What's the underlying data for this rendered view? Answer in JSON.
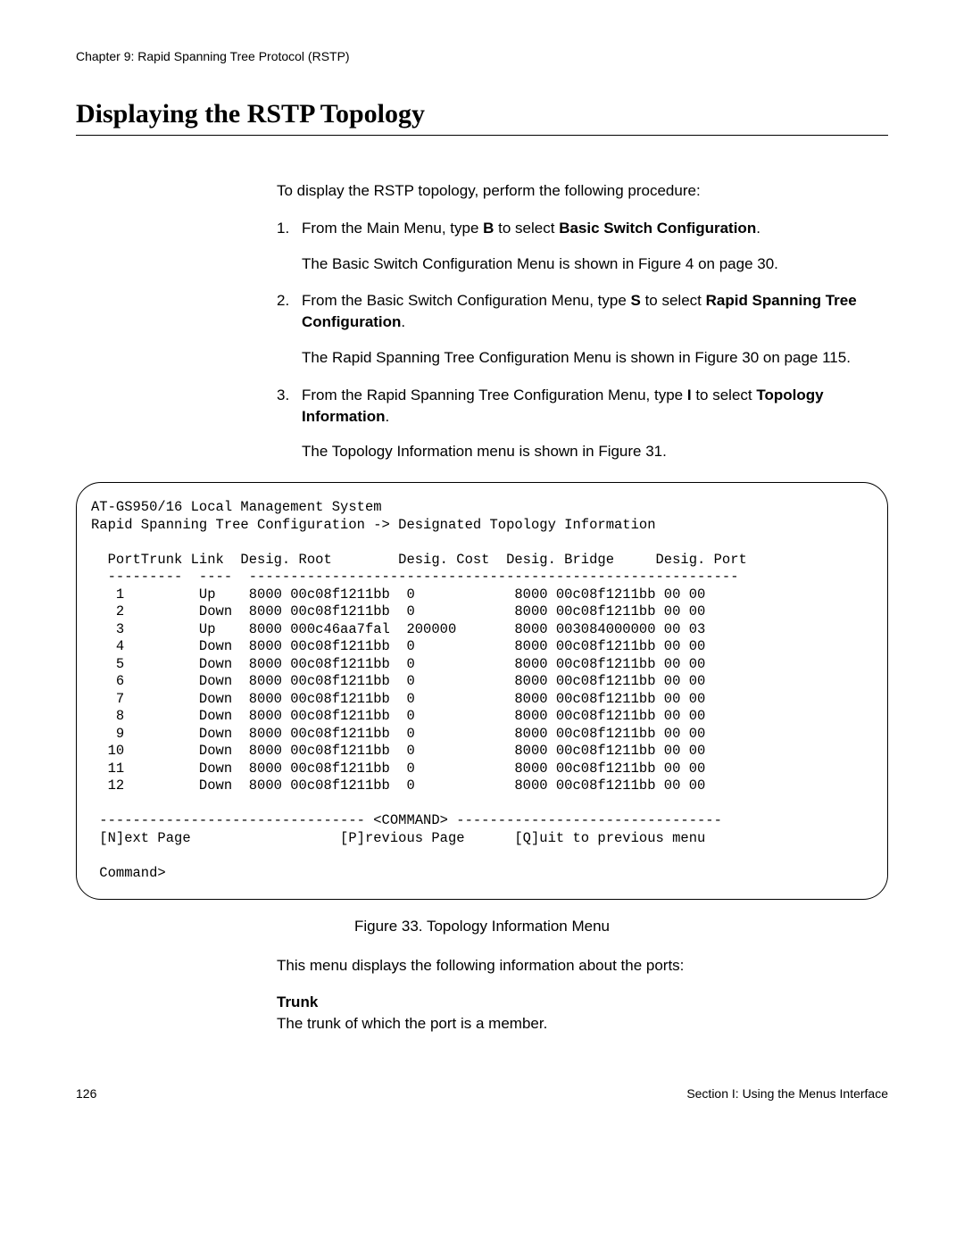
{
  "header": {
    "chapter": "Chapter 9: Rapid Spanning Tree Protocol (RSTP)"
  },
  "title": "Displaying the RSTP Topology",
  "intro": "To display the RSTP topology, perform the following procedure:",
  "steps": [
    {
      "num": "1.",
      "pre": "From the Main Menu, type ",
      "key": "B",
      "mid": " to select ",
      "bold": "Basic Switch Configuration",
      "post": ".",
      "extra": "The Basic Switch Configuration Menu is shown in Figure 4 on page 30."
    },
    {
      "num": "2.",
      "pre": "From the Basic Switch Configuration Menu, type ",
      "key": "S",
      "mid": " to select ",
      "bold": "Rapid Spanning Tree Configuration",
      "post": ".",
      "extra": "The Rapid Spanning Tree Configuration Menu is shown in Figure 30 on page 115."
    },
    {
      "num": "3.",
      "pre": "From the Rapid Spanning Tree Configuration Menu, type ",
      "key": "I",
      "mid": " to select ",
      "bold": "Topology Information",
      "post": ".",
      "extra": "The Topology Information menu is shown in Figure 31."
    }
  ],
  "terminal": {
    "line1": "AT-GS950/16 Local Management System",
    "line2": "Rapid Spanning Tree Configuration -> Designated Topology Information",
    "header": "  PortTrunk Link  Desig. Root        Desig. Cost  Desig. Bridge     Desig. Port",
    "divider": "  ---------  ----  -----------------------------------------------------------",
    "rows": [
      "   1         Up    8000 00c08f1211bb  0            8000 00c08f1211bb 00 00",
      "   2         Down  8000 00c08f1211bb  0            8000 00c08f1211bb 00 00",
      "   3         Up    8000 000c46aa7fal  200000       8000 003084000000 00 03",
      "   4         Down  8000 00c08f1211bb  0            8000 00c08f1211bb 00 00",
      "   5         Down  8000 00c08f1211bb  0            8000 00c08f1211bb 00 00",
      "   6         Down  8000 00c08f1211bb  0            8000 00c08f1211bb 00 00",
      "   7         Down  8000 00c08f1211bb  0            8000 00c08f1211bb 00 00",
      "   8         Down  8000 00c08f1211bb  0            8000 00c08f1211bb 00 00",
      "   9         Down  8000 00c08f1211bb  0            8000 00c08f1211bb 00 00",
      "  10         Down  8000 00c08f1211bb  0            8000 00c08f1211bb 00 00",
      "  11         Down  8000 00c08f1211bb  0            8000 00c08f1211bb 00 00",
      "  12         Down  8000 00c08f1211bb  0            8000 00c08f1211bb 00 00"
    ],
    "cmdbar": " -------------------------------- <COMMAND> --------------------------------",
    "cmds": " [N]ext Page                  [P]revious Page      [Q]uit to previous menu",
    "prompt": " Command>"
  },
  "caption": "Figure 33. Topology Information Menu",
  "after_caption": "This menu displays the following information about the ports:",
  "term_label": "Trunk",
  "term_desc": "The trunk of which the port is a member.",
  "footer": {
    "left": "126",
    "right": "Section I: Using the Menus Interface"
  },
  "chart_data": {
    "type": "table",
    "title": "Designated Topology Information",
    "columns": [
      "Port",
      "Trunk",
      "Link",
      "Desig. Root",
      "Desig. Cost",
      "Desig. Bridge",
      "Desig. Port"
    ],
    "rows": [
      {
        "Port": 1,
        "Trunk": "",
        "Link": "Up",
        "Desig. Root": "8000 00c08f1211bb",
        "Desig. Cost": 0,
        "Desig. Bridge": "8000 00c08f1211bb",
        "Desig. Port": "00 00"
      },
      {
        "Port": 2,
        "Trunk": "",
        "Link": "Down",
        "Desig. Root": "8000 00c08f1211bb",
        "Desig. Cost": 0,
        "Desig. Bridge": "8000 00c08f1211bb",
        "Desig. Port": "00 00"
      },
      {
        "Port": 3,
        "Trunk": "",
        "Link": "Up",
        "Desig. Root": "8000 000c46aa7fal",
        "Desig. Cost": 200000,
        "Desig. Bridge": "8000 003084000000",
        "Desig. Port": "00 03"
      },
      {
        "Port": 4,
        "Trunk": "",
        "Link": "Down",
        "Desig. Root": "8000 00c08f1211bb",
        "Desig. Cost": 0,
        "Desig. Bridge": "8000 00c08f1211bb",
        "Desig. Port": "00 00"
      },
      {
        "Port": 5,
        "Trunk": "",
        "Link": "Down",
        "Desig. Root": "8000 00c08f1211bb",
        "Desig. Cost": 0,
        "Desig. Bridge": "8000 00c08f1211bb",
        "Desig. Port": "00 00"
      },
      {
        "Port": 6,
        "Trunk": "",
        "Link": "Down",
        "Desig. Root": "8000 00c08f1211bb",
        "Desig. Cost": 0,
        "Desig. Bridge": "8000 00c08f1211bb",
        "Desig. Port": "00 00"
      },
      {
        "Port": 7,
        "Trunk": "",
        "Link": "Down",
        "Desig. Root": "8000 00c08f1211bb",
        "Desig. Cost": 0,
        "Desig. Bridge": "8000 00c08f1211bb",
        "Desig. Port": "00 00"
      },
      {
        "Port": 8,
        "Trunk": "",
        "Link": "Down",
        "Desig. Root": "8000 00c08f1211bb",
        "Desig. Cost": 0,
        "Desig. Bridge": "8000 00c08f1211bb",
        "Desig. Port": "00 00"
      },
      {
        "Port": 9,
        "Trunk": "",
        "Link": "Down",
        "Desig. Root": "8000 00c08f1211bb",
        "Desig. Cost": 0,
        "Desig. Bridge": "8000 00c08f1211bb",
        "Desig. Port": "00 00"
      },
      {
        "Port": 10,
        "Trunk": "",
        "Link": "Down",
        "Desig. Root": "8000 00c08f1211bb",
        "Desig. Cost": 0,
        "Desig. Bridge": "8000 00c08f1211bb",
        "Desig. Port": "00 00"
      },
      {
        "Port": 11,
        "Trunk": "",
        "Link": "Down",
        "Desig. Root": "8000 00c08f1211bb",
        "Desig. Cost": 0,
        "Desig. Bridge": "8000 00c08f1211bb",
        "Desig. Port": "00 00"
      },
      {
        "Port": 12,
        "Trunk": "",
        "Link": "Down",
        "Desig. Root": "8000 00c08f1211bb",
        "Desig. Cost": 0,
        "Desig. Bridge": "8000 00c08f1211bb",
        "Desig. Port": "00 00"
      }
    ]
  }
}
